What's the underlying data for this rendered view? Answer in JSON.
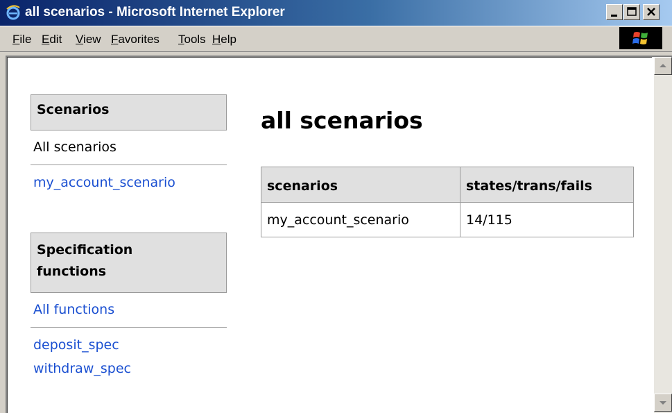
{
  "window": {
    "title": "all scenarios - Microsoft Internet Explorer"
  },
  "menu": {
    "file": "File",
    "edit": "Edit",
    "view": "View",
    "favorites": "Favorites",
    "tools": "Tools",
    "help": "Help"
  },
  "sidebar": {
    "scenarios_heading": "Scenarios",
    "all_scenarios": "All scenarios",
    "scenario_links": [
      "my_account_scenario"
    ],
    "spec_heading_line1": "Specification",
    "spec_heading_line2": "functions",
    "all_functions": "All functions",
    "function_links": [
      "deposit_spec",
      "withdraw_spec"
    ]
  },
  "main": {
    "title": "all scenarios",
    "table": {
      "headers": [
        "scenarios",
        "states/trans/fails"
      ],
      "rows": [
        [
          "my_account_scenario",
          "14/115"
        ]
      ]
    }
  },
  "colors": {
    "link": "#1a4fd1",
    "heading_bg": "#e0e0e0",
    "titlebar_start": "#0a246a",
    "titlebar_end": "#a6caf0"
  },
  "icons": {
    "title_icon": "ie-logo-icon",
    "menu_logo": "windows-logo-icon"
  }
}
